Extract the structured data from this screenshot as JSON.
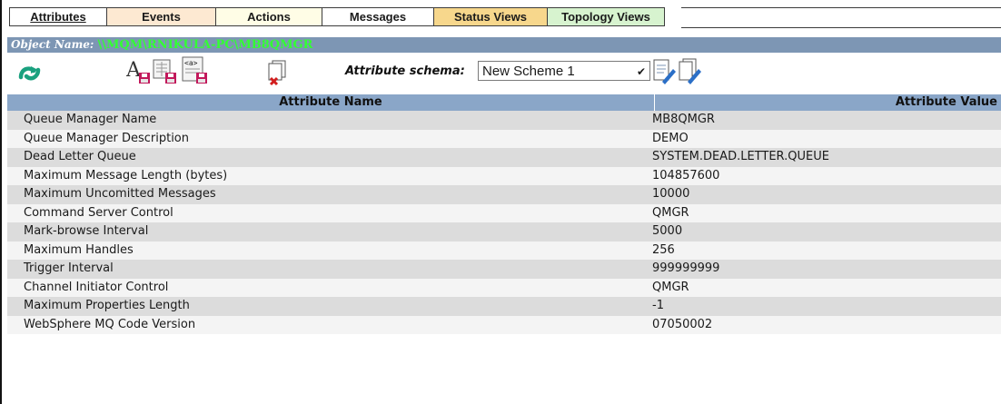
{
  "tabs": [
    {
      "label": "Attributes",
      "bg": "#ffffff",
      "width": 106,
      "active": true
    },
    {
      "label": "Events",
      "bg": "#fde9d2",
      "width": 119,
      "active": false
    },
    {
      "label": "Actions",
      "bg": "#fffde6",
      "width": 116,
      "active": false
    },
    {
      "label": "Messages",
      "bg": "#ffffff",
      "width": 122,
      "active": false
    },
    {
      "label": "Status Views",
      "bg": "#f7d78c",
      "width": 124,
      "active": false
    },
    {
      "label": "Topology Views",
      "bg": "#d7f3cf",
      "width": 128,
      "active": false
    }
  ],
  "object": {
    "label": "Object Name:",
    "value": "\\\\MQM\\RNIKULA-PC\\MB8QMGR"
  },
  "toolbar": {
    "schema_label": "Attribute schema:",
    "schema_value": "New Scheme 1",
    "icons": [
      "refresh-icon",
      "save-font-icon",
      "save-table-icon",
      "save-xml-icon",
      "delete-icon",
      "edit-schema-icon",
      "new-schema-icon"
    ]
  },
  "table": {
    "headers": [
      "Attribute Name",
      "Attribute Value"
    ],
    "rows": [
      [
        "Queue Manager Name",
        "MB8QMGR"
      ],
      [
        "Queue Manager Description",
        "DEMO"
      ],
      [
        "Dead Letter Queue",
        "SYSTEM.DEAD.LETTER.QUEUE"
      ],
      [
        "Maximum Message Length (bytes)",
        "104857600"
      ],
      [
        "Maximum Uncomitted Messages",
        "10000"
      ],
      [
        "Command Server Control",
        "QMGR"
      ],
      [
        "Mark-browse Interval",
        "5000"
      ],
      [
        "Maximum Handles",
        "256"
      ],
      [
        "Trigger Interval",
        "999999999"
      ],
      [
        "Channel Initiator Control",
        "QMGR"
      ],
      [
        "Maximum Properties Length",
        "-1"
      ],
      [
        "WebSphere MQ Code Version",
        "07050002"
      ]
    ]
  }
}
